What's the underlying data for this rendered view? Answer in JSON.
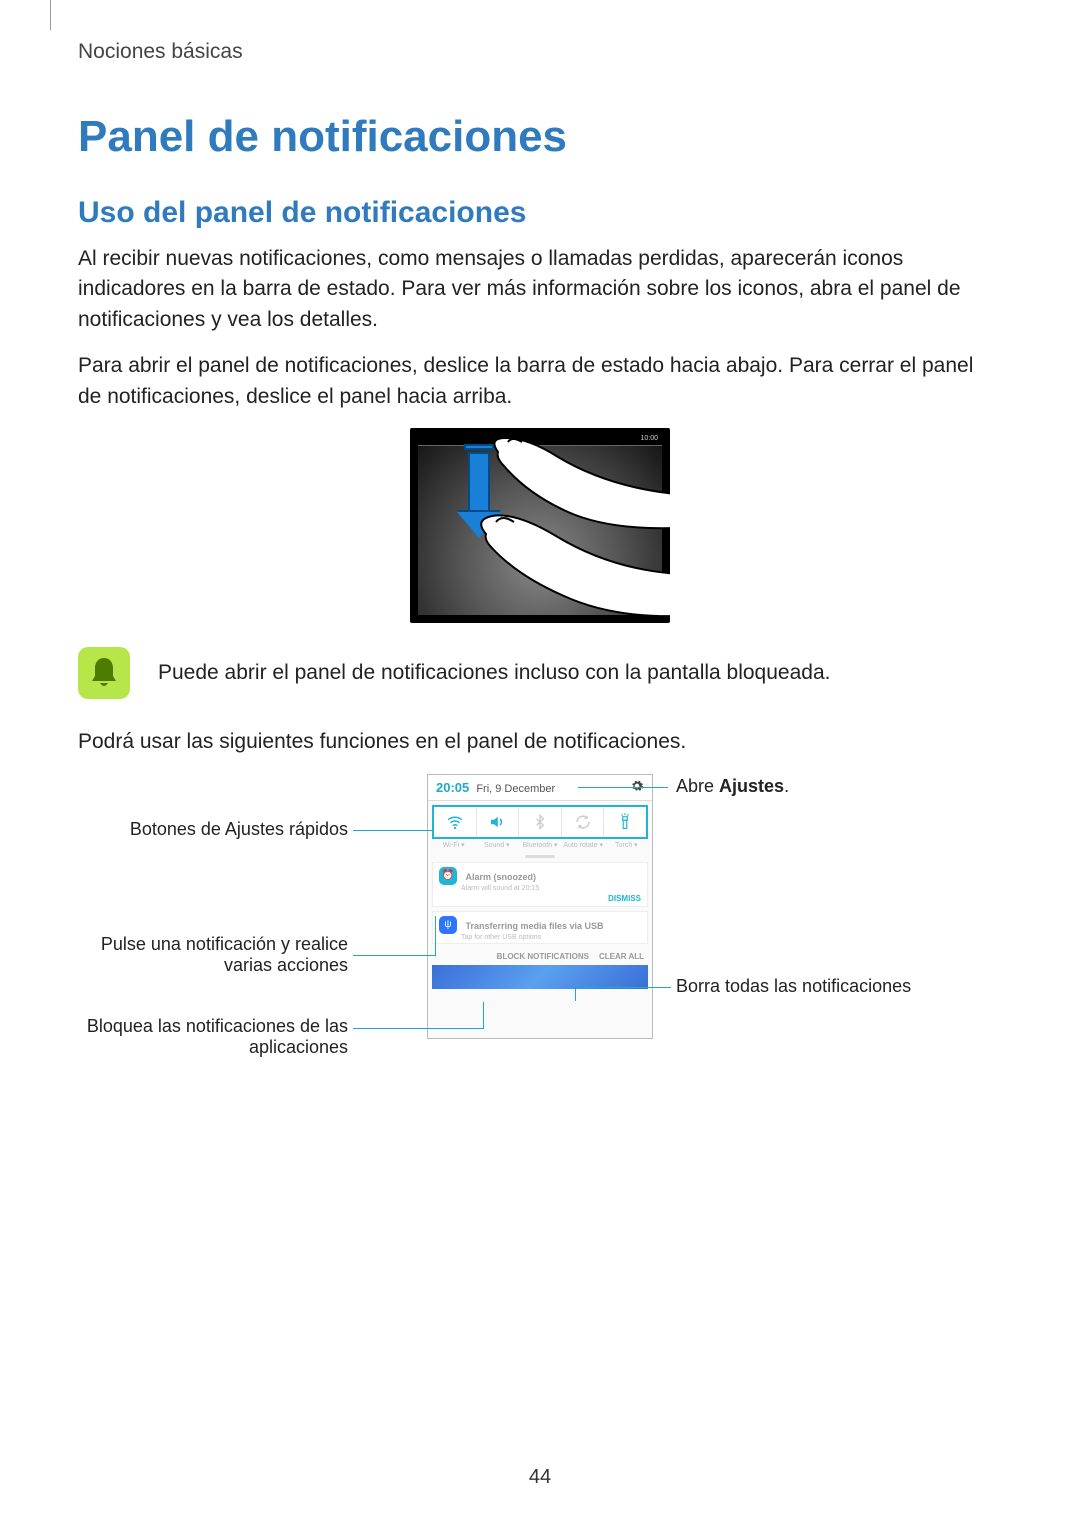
{
  "crumb": "Nociones básicas",
  "h1": "Panel de notificaciones",
  "h2": "Uso del panel de notificaciones",
  "para1": "Al recibir nuevas notificaciones, como mensajes o llamadas perdidas, aparecerán iconos indicadores en la barra de estado. Para ver más información sobre los iconos, abra el panel de notificaciones y vea los detalles.",
  "para2": "Para abrir el panel de notificaciones, deslice la barra de estado hacia abajo. Para cerrar el panel de notificaciones, deslice el panel hacia arriba.",
  "note": "Puede abrir el panel de notificaciones incluso con la pantalla bloqueada.",
  "para3": "Podrá usar las siguientes funciones en el panel de notificaciones.",
  "phone": {
    "time": "20:05",
    "date": "Fri, 9 December",
    "qs_labels": [
      "Wi-Fi ▾",
      "Sound ▾",
      "Bluetooth ▾",
      "Auto rotate ▾",
      "Torch ▾"
    ],
    "notif1_title": "Alarm (snoozed)",
    "notif1_sub": "Alarm will sound at 20:15",
    "notif1_action": "DISMISS",
    "notif2_title": "Transferring media files via USB",
    "notif2_sub": "Tap for other USB options",
    "action_block": "BLOCK NOTIFICATIONS",
    "action_clear": "CLEAR ALL"
  },
  "callouts": {
    "settings_pre": "Abre ",
    "settings_bold": "Ajustes",
    "settings_post": ".",
    "quick": "Botones de Ajustes rápidos",
    "tap": "Pulse una notificación y realice varias acciones",
    "block": "Bloquea las notificaciones de las aplicaciones",
    "clear": "Borra todas las notificaciones"
  },
  "page_number": "44"
}
